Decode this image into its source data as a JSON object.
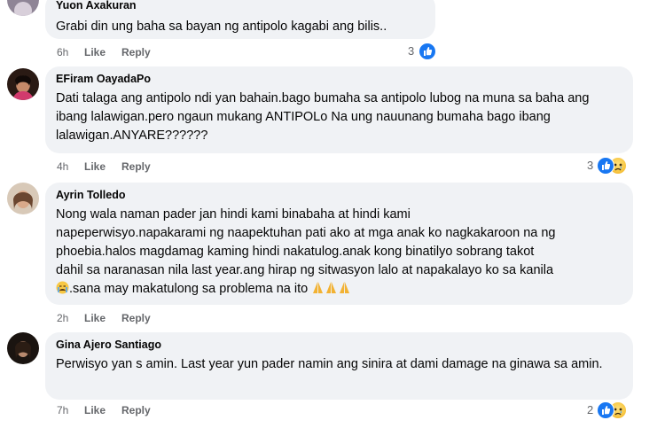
{
  "action_labels": {
    "like": "Like",
    "reply": "Reply"
  },
  "comments": [
    {
      "author": "Yuon Axakuran",
      "text": "Grabi din ung baha sa bayan ng antipolo kagabi ang bilis..",
      "time": "6h",
      "reactions": "3"
    },
    {
      "author": "EFiram OayadaPo",
      "text": "Dati talaga ang antipolo ndi yan bahain.bago bumaha sa antipolo lubog na muna sa baha ang ibang lalawigan.pero ngaun mukang ANTIPOLo Na ung nauunang bumaha bago ibang lalawigan.ANYARE??????",
      "time": "4h",
      "reactions": "3"
    },
    {
      "author": "Ayrin Tolledo",
      "text_lines": [
        "Nong wala naman pader jan hindi kami binabaha at hindi kami",
        "napeperwisyo.napakarami ng naapektuhan pati ako at mga anak ko nagkakaroon na ng",
        "phoebia.halos magdamag kaming hindi nakatulog.anak kong binatilyo sobrang takot",
        "dahil sa naranasan nila last year.ang hirap ng sitwasyon lalo at napakalayo ko sa kanila",
        ".sana may makatulong sa problema na ito"
      ],
      "time": "2h"
    },
    {
      "author": "Gina Ajero Santiago",
      "text": "Perwisyo yan s amin. Last year yun pader namin ang sinira at dami damage na ginawa sa amin.",
      "time": "7h",
      "reactions": "2"
    }
  ],
  "colors": {
    "bubble": "#f0f2f5",
    "like_blue": "#1877f2",
    "meta_gray": "#65676b"
  }
}
